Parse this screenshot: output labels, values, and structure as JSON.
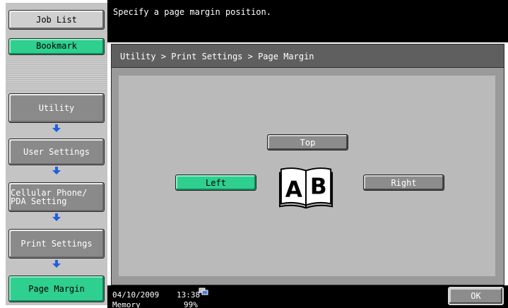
{
  "sidebar": {
    "job_list": "Job List",
    "bookmark": "Bookmark",
    "breadcrumb_items": [
      {
        "label": "Utility"
      },
      {
        "label": "User Settings"
      },
      {
        "label_line1": "Cellular Phone/",
        "label_line2": "PDA Setting"
      },
      {
        "label": "Print Settings"
      },
      {
        "label": "Page Margin"
      }
    ],
    "arrow_color": "#1e5fe0"
  },
  "message": "Specify a page margin position.",
  "panel": {
    "breadcrumb": "Utility > Print Settings > Page Margin",
    "buttons": {
      "top": "Top",
      "left": "Left",
      "right": "Right"
    },
    "illustration": {
      "icon": "book-icon",
      "left_letter": "A",
      "right_letter": "B"
    }
  },
  "status": {
    "date": "04/10/2009",
    "time": "13:38",
    "memory_label": "Memory",
    "memory_value": "99%",
    "network_icon": "network-icon"
  },
  "ok_label": "OK",
  "colors": {
    "selected": "#2ecf8f",
    "button_gray": "#8c8c8c",
    "panel_bg": "#bababa"
  }
}
